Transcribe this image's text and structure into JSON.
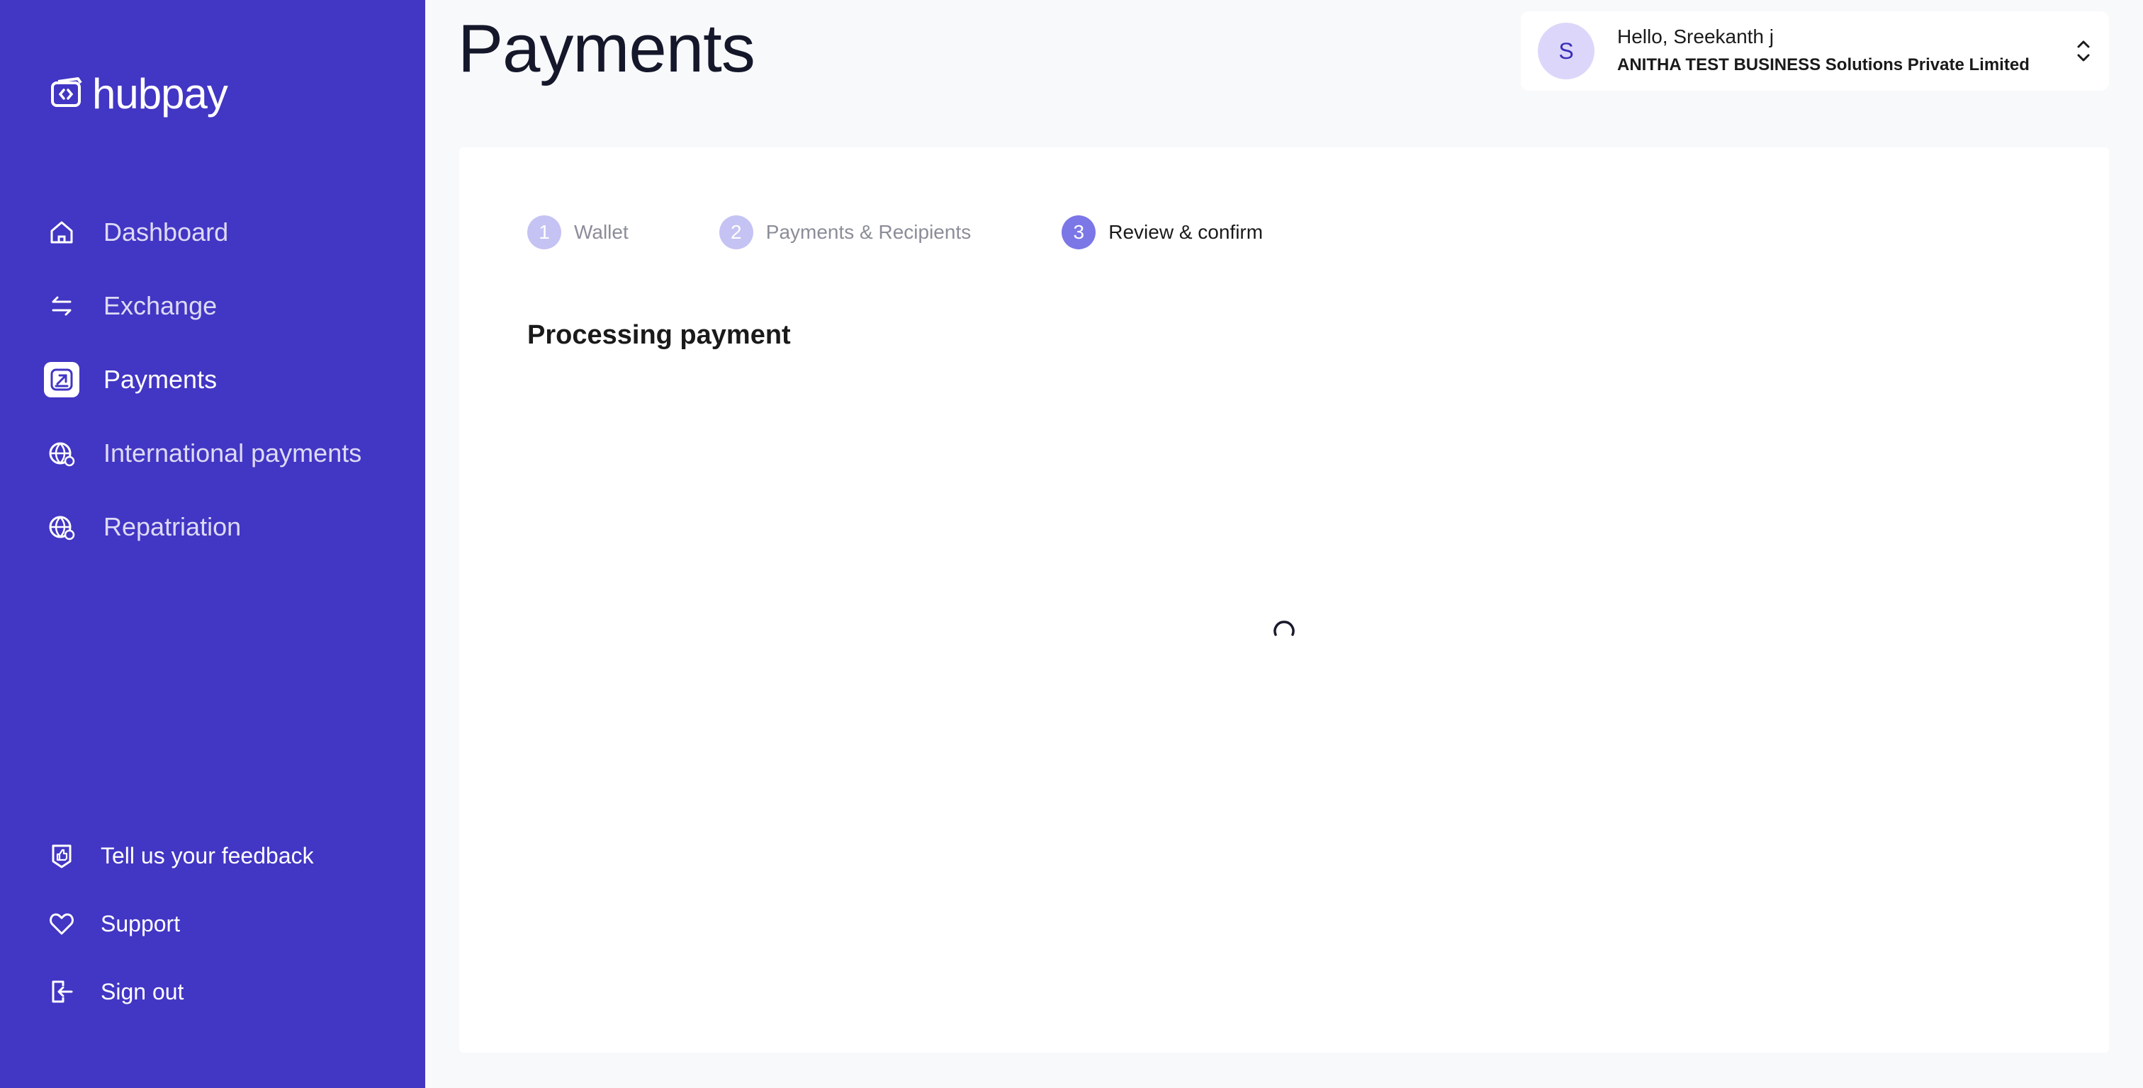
{
  "sidebar": {
    "logo": "hubpay",
    "nav": [
      {
        "label": "Dashboard",
        "icon": "home-icon"
      },
      {
        "label": "Exchange",
        "icon": "exchange-icon"
      },
      {
        "label": "Payments",
        "icon": "payments-icon",
        "active": true
      },
      {
        "label": "International payments",
        "icon": "globe-icon"
      },
      {
        "label": "Repatriation",
        "icon": "globe-icon"
      }
    ],
    "bottom": [
      {
        "label": "Tell us your feedback",
        "icon": "feedback-icon"
      },
      {
        "label": "Support",
        "icon": "heart-icon"
      },
      {
        "label": "Sign out",
        "icon": "sign-out-icon"
      }
    ],
    "color": "#4236c4"
  },
  "header": {
    "title": "Payments",
    "user": {
      "initial": "S",
      "greeting": "Hello, Sreekanth j",
      "company": "ANITHA TEST BUSINESS Solutions Private Limited"
    }
  },
  "steps": [
    {
      "num": "1",
      "label": "Wallet"
    },
    {
      "num": "2",
      "label": "Payments & Recipients"
    },
    {
      "num": "3",
      "label": "Review & confirm",
      "current": true
    }
  ],
  "main": {
    "status": "Processing payment"
  }
}
